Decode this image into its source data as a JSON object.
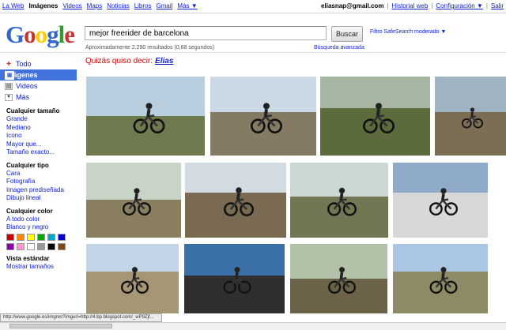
{
  "topnav": {
    "left": [
      "La Web",
      "Imágenes",
      "Videos",
      "Maps",
      "Noticias",
      "Libros",
      "Gmail",
      "Más ▼"
    ],
    "active_index": 1,
    "email": "eliasnap@gmail.com",
    "right_links": [
      "Historial web",
      "Configuración ▼",
      "Salir"
    ]
  },
  "logo": [
    "G",
    "o",
    "o",
    "g",
    "l",
    "e"
  ],
  "logo_colors": [
    "#3366cc",
    "#cc3333",
    "#ffcc00",
    "#3366cc",
    "#339933",
    "#cc3333"
  ],
  "search": {
    "value": "mejor freerider de barcelona",
    "button": "Buscar"
  },
  "safesearch": "Filtro SafeSearch moderado ▼",
  "stats": "Aproximadamente 2.290 resultados (0,88 segundos)",
  "advanced": "Búsqueda avanzada",
  "didyoumean": {
    "prefix": "Quizás quiso decir:",
    "term": "Elias"
  },
  "sidebar": {
    "nav": [
      {
        "label": "Todo",
        "icon": "search-all-icon"
      },
      {
        "label": "Imágenes",
        "icon": "images-icon"
      },
      {
        "label": "Videos",
        "icon": "video-icon"
      },
      {
        "label": "Más",
        "icon": "more-icon"
      }
    ],
    "groups": [
      {
        "title": "Cualquier tamaño",
        "options": [
          "Grande",
          "Mediano",
          "Icono",
          "Mayor que...",
          "Tamaño exacto..."
        ]
      },
      {
        "title": "Cualquier tipo",
        "options": [
          "Cara",
          "Fotografía",
          "Imagen prediseñada",
          "Dibujo lineal"
        ]
      },
      {
        "title": "Cualquier color",
        "options": [
          "A todo color",
          "Blanco y negro"
        ]
      },
      {
        "title": "Vista estándar",
        "options": [
          "Mostrar tamaños"
        ]
      }
    ],
    "swatches": [
      "#cc0000",
      "#ff8800",
      "#ffff00",
      "#00aa00",
      "#00aacc",
      "#0000cc",
      "#8800aa",
      "#ff99cc",
      "#ffffff",
      "#999999",
      "#000000",
      "#884411"
    ]
  },
  "status_url": "http://www.google.es/imgres?imgurl=http://4.bp.blogspot.com/_wP9Zjf..."
}
